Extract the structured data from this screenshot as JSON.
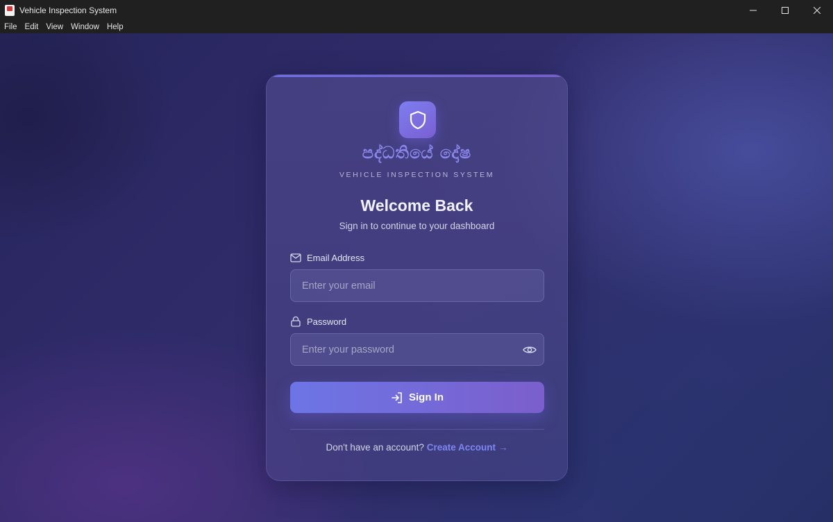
{
  "window": {
    "title": "Vehicle Inspection System"
  },
  "menu": {
    "items": [
      "File",
      "Edit",
      "View",
      "Window",
      "Help"
    ]
  },
  "brand": {
    "name_sinhala": "පද්ධතියේ දෝෂ",
    "subtitle": "VEHICLE INSPECTION SYSTEM",
    "logo_icon": "shield-icon"
  },
  "login": {
    "heading": "Welcome Back",
    "subheading": "Sign in to continue to your dashboard",
    "email_label": "Email Address",
    "email_placeholder": "Enter your email",
    "password_label": "Password",
    "password_placeholder": "Enter your password",
    "submit_label": "Sign In",
    "footer_text": "Don't have an account?",
    "footer_link": "Create Account",
    "footer_arrow": "→"
  },
  "colors": {
    "accent": "#6f6fe8",
    "button_start": "#6d75e6",
    "button_end": "#7b5fcc",
    "link": "#7f86f4"
  }
}
